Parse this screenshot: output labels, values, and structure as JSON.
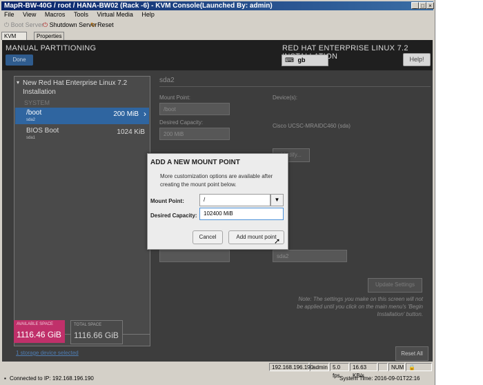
{
  "window": {
    "title": "MapR-BW-40G / root / HANA-BW02 (Rack -6) - KVM Console(Launched By: admin)",
    "controls": {
      "minimize": "_",
      "maximize": "□",
      "close": "×"
    }
  },
  "menu": [
    "File",
    "View",
    "Macros",
    "Tools",
    "Virtual Media",
    "Help"
  ],
  "toolbar": {
    "boot": "Boot Server",
    "shutdown": "Shutdown Server",
    "reset": "Reset"
  },
  "tabs": [
    "KVM Console",
    "Properties"
  ],
  "installer": {
    "title": "MANUAL PARTITIONING",
    "product": "RED HAT ENTERPRISE LINUX 7.2 INSTALLATION",
    "done": "Done",
    "keyboard": "gb",
    "help": "Help!"
  },
  "left_panel": {
    "header": "New Red Hat Enterprise Linux 7.2 Installation",
    "section": "SYSTEM",
    "items": [
      {
        "name": "/boot",
        "dev": "sda2",
        "size": "200 MiB"
      },
      {
        "name": "BIOS Boot",
        "dev": "sda1",
        "size": "1024 KiB"
      }
    ],
    "buttons": {
      "add": "+",
      "remove": "−",
      "refresh": "↻"
    }
  },
  "details": {
    "partition": "sda2",
    "mount_label": "Mount Point:",
    "mount_value": "/boot",
    "device_label": "Device(s):",
    "capacity_label": "Desired Capacity:",
    "capacity_value": "200 MiB",
    "device_value": "Cisco UCSC-MRAIDC460 (sda)",
    "modify": "Modify...",
    "name_value": "sda2",
    "update": "Update Settings",
    "note": "Note:  The settings you make on this screen will not be applied until you click on the main menu's 'Begin Installation' button."
  },
  "space": {
    "available_label": "AVAILABLE SPACE",
    "available_value": "1116.46 GiB",
    "total_label": "TOTAL SPACE",
    "total_value": "1116.66 GiB",
    "available_color": "#c0306a",
    "total_color": "#4a4a4a"
  },
  "storage_link": "1 storage device selected",
  "reset_all": "Reset All",
  "dialog": {
    "title": "ADD A NEW MOUNT POINT",
    "text": "More customization options are available after creating the mount point below.",
    "mount_label": "Mount Point:",
    "mount_value": "/",
    "capacity_label": "Desired Capacity:",
    "capacity_value": "102400 MiB",
    "cancel": "Cancel",
    "add": "Add mount point"
  },
  "status": {
    "ip": "192.168.196.190",
    "user": "admin",
    "fps": "5.0 fps",
    "rate": "16.63 KB/s",
    "num": "NUM"
  },
  "bottom": {
    "connected": "Connected to IP: 192.168.196.190",
    "time": "System Time: 2016-09-01T22:16"
  }
}
